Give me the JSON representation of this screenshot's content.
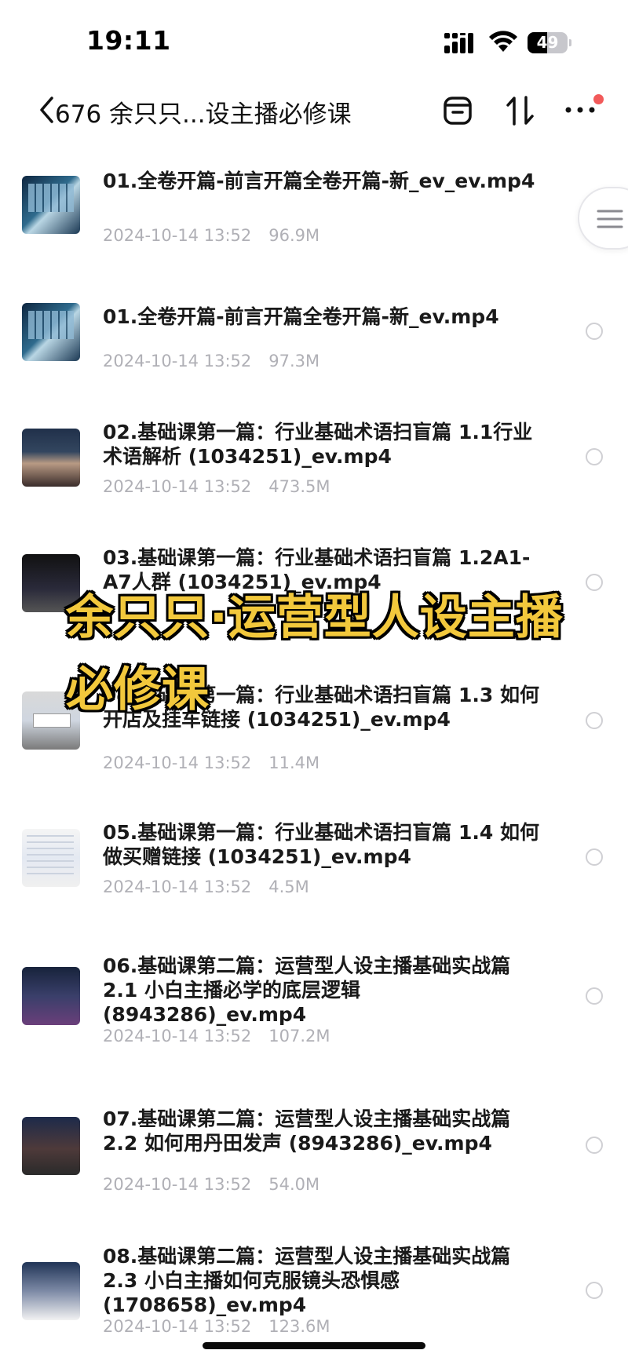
{
  "status_bar": {
    "time": "19:11",
    "battery_text": "49",
    "battery_level": 0.49,
    "icons": [
      "signal-icon",
      "wifi-icon",
      "battery-icon"
    ]
  },
  "header": {
    "title": "676 余只只...设主播必修课",
    "icons": [
      "back-icon",
      "archive-icon",
      "sort-icon",
      "more-icon"
    ],
    "notify_dot_color": "#f25a5a"
  },
  "files": [
    {
      "name": "01.全卷开篇-前言开篇全卷开篇-新_ev_ev.mp4",
      "date": "2024-10-14 13:52",
      "size": "96.9M"
    },
    {
      "name": "01.全卷开篇-前言开篇全卷开篇-新_ev.mp4",
      "date": "2024-10-14 13:52",
      "size": "97.3M"
    },
    {
      "name": "02.基础课第一篇：行业基础术语扫盲篇 1.1行业术语解析 (1034251)_ev.mp4",
      "date": "2024-10-14 13:52",
      "size": "473.5M"
    },
    {
      "name": "03.基础课第一篇：行业基础术语扫盲篇 1.2A1-A7人群 (1034251)_ev.mp4",
      "date": "",
      "size": ""
    },
    {
      "name": "04.基础课第一篇：行业基础术语扫盲篇 1.3 如何开店及挂车链接 (1034251)_ev.mp4",
      "date": "2024-10-14 13:52",
      "size": "11.4M"
    },
    {
      "name": "05.基础课第一篇：行业基础术语扫盲篇 1.4 如何做买赠链接 (1034251)_ev.mp4",
      "date": "2024-10-14 13:52",
      "size": "4.5M"
    },
    {
      "name": "06.基础课第二篇：运营型人设主播基础实战篇 2.1 小白主播必学的底层逻辑 (8943286)_ev.mp4",
      "date": "2024-10-14 13:52",
      "size": "107.2M"
    },
    {
      "name": "07.基础课第二篇：运营型人设主播基础实战篇 2.2 如何用丹田发声 (8943286)_ev.mp4",
      "date": "2024-10-14 13:52",
      "size": "54.0M"
    },
    {
      "name": "08.基础课第二篇：运营型人设主播基础实战篇 2.3 小白主播如何克服镜头恐惧感 (1708658)_ev.mp4",
      "date": "2024-10-14 13:52",
      "size": "123.6M"
    }
  ],
  "overlay": {
    "line1": "余只只·运营型人设主播",
    "line2": "必修课",
    "color": "#f2c83c"
  },
  "accent_colors": {
    "meta_text": "#b0b0b6",
    "radio_border": "#d0d0d4"
  }
}
